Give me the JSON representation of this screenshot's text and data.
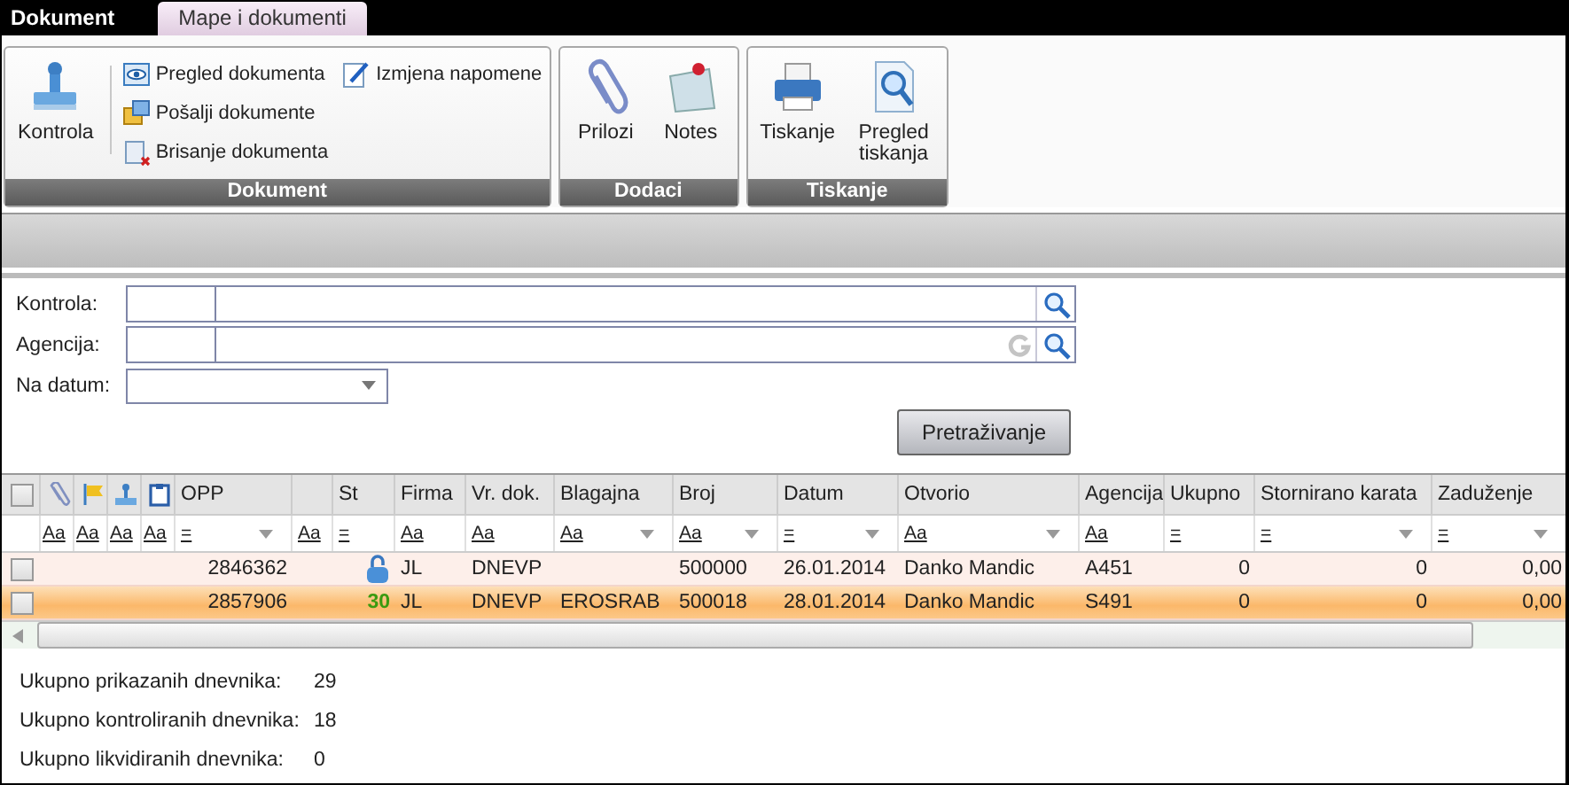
{
  "tabs": [
    {
      "label": "Dokument",
      "selected": false
    },
    {
      "label": "Mape i dokumenti",
      "selected": true
    }
  ],
  "ribbon": {
    "groups": [
      {
        "title": "Dokument",
        "items": [
          {
            "label": "Kontrola",
            "kind": "large"
          },
          {
            "label": "Pregled dokumenta",
            "kind": "small"
          },
          {
            "label": "Pošalji dokumente",
            "kind": "small"
          },
          {
            "label": "Brisanje dokumenta",
            "kind": "small"
          },
          {
            "label": "Izmjena napomene",
            "kind": "small"
          }
        ]
      },
      {
        "title": "Dodaci",
        "items": [
          {
            "label": "Prilozi",
            "kind": "large"
          },
          {
            "label": "Notes",
            "kind": "large"
          }
        ]
      },
      {
        "title": "Tiskanje",
        "items": [
          {
            "label": "Tiskanje",
            "kind": "large"
          },
          {
            "label": "Pregled tiskanja",
            "kind": "large"
          }
        ]
      }
    ]
  },
  "filter": {
    "fields": [
      {
        "label": "Kontrola:",
        "kind": "lookup"
      },
      {
        "label": "Agencija:",
        "kind": "lookup-reset"
      },
      {
        "label": "Na datum:",
        "kind": "date"
      }
    ],
    "search_button": "Pretraživanje"
  },
  "table": {
    "columns": [
      {
        "kind": "check",
        "checked": false
      },
      {
        "kind": "icon",
        "filter": "Aa",
        "dropdown": false
      },
      {
        "kind": "icon",
        "filter": "Aa",
        "dropdown": false
      },
      {
        "kind": "icon",
        "filter": "Aa",
        "dropdown": false
      },
      {
        "kind": "icon",
        "filter": "Aa",
        "dropdown": false
      },
      {
        "kind": "text",
        "label": "OPP",
        "filter": "=",
        "dropdown": true
      },
      {
        "kind": "text",
        "filter": "Aa",
        "dropdown": false
      },
      {
        "kind": "text",
        "label": "St",
        "filter": "=",
        "dropdown": false
      },
      {
        "kind": "text",
        "label": "Firma",
        "filter": "Aa",
        "dropdown": false
      },
      {
        "kind": "text",
        "label": "Vr. dok.",
        "filter": "Aa",
        "dropdown": false
      },
      {
        "kind": "text",
        "label": "Blagajna",
        "filter": "Aa",
        "dropdown": true
      },
      {
        "kind": "text",
        "label": "Broj",
        "filter": "Aa",
        "dropdown": true
      },
      {
        "kind": "text",
        "label": "Datum",
        "filter": "=",
        "dropdown": true
      },
      {
        "kind": "text",
        "label": "Otvorio",
        "filter": "Aa",
        "dropdown": true
      },
      {
        "kind": "text",
        "label": "Agencija",
        "filter": "Aa",
        "dropdown": false
      },
      {
        "kind": "text",
        "label": "Ukupno",
        "filter": "=",
        "dropdown": false
      },
      {
        "kind": "text",
        "label": "Stornirano karata",
        "filter": "=",
        "dropdown": true
      },
      {
        "kind": "text",
        "label": "Zaduženje",
        "filter": "=",
        "dropdown": true
      }
    ],
    "rows": [
      {
        "selected": false,
        "checked": false,
        "locked": true,
        "cells": [
          null,
          null,
          null,
          null,
          null,
          "2846362",
          null,
          null,
          "JL",
          "DNEVP",
          null,
          "500000",
          "26.01.2014",
          "Danko Mandic",
          "A451",
          "0",
          "0",
          "0,00"
        ]
      },
      {
        "selected": true,
        "checked": false,
        "locked": false,
        "cells": [
          null,
          null,
          null,
          null,
          null,
          "2857906",
          null,
          "30",
          "JL",
          "DNEVP",
          "EROSRAB",
          "500018",
          "28.01.2014",
          "Danko Mandic",
          "S491",
          "0",
          "0",
          "0,00"
        ]
      }
    ]
  },
  "summary": [
    {
      "label": "Ukupno prikazanih dnevnika:",
      "value": "29"
    },
    {
      "label": "Ukupno kontroliranih dnevnika:",
      "value": "18"
    },
    {
      "label": "Ukupno likvidiranih dnevnika:",
      "value": "0"
    }
  ]
}
